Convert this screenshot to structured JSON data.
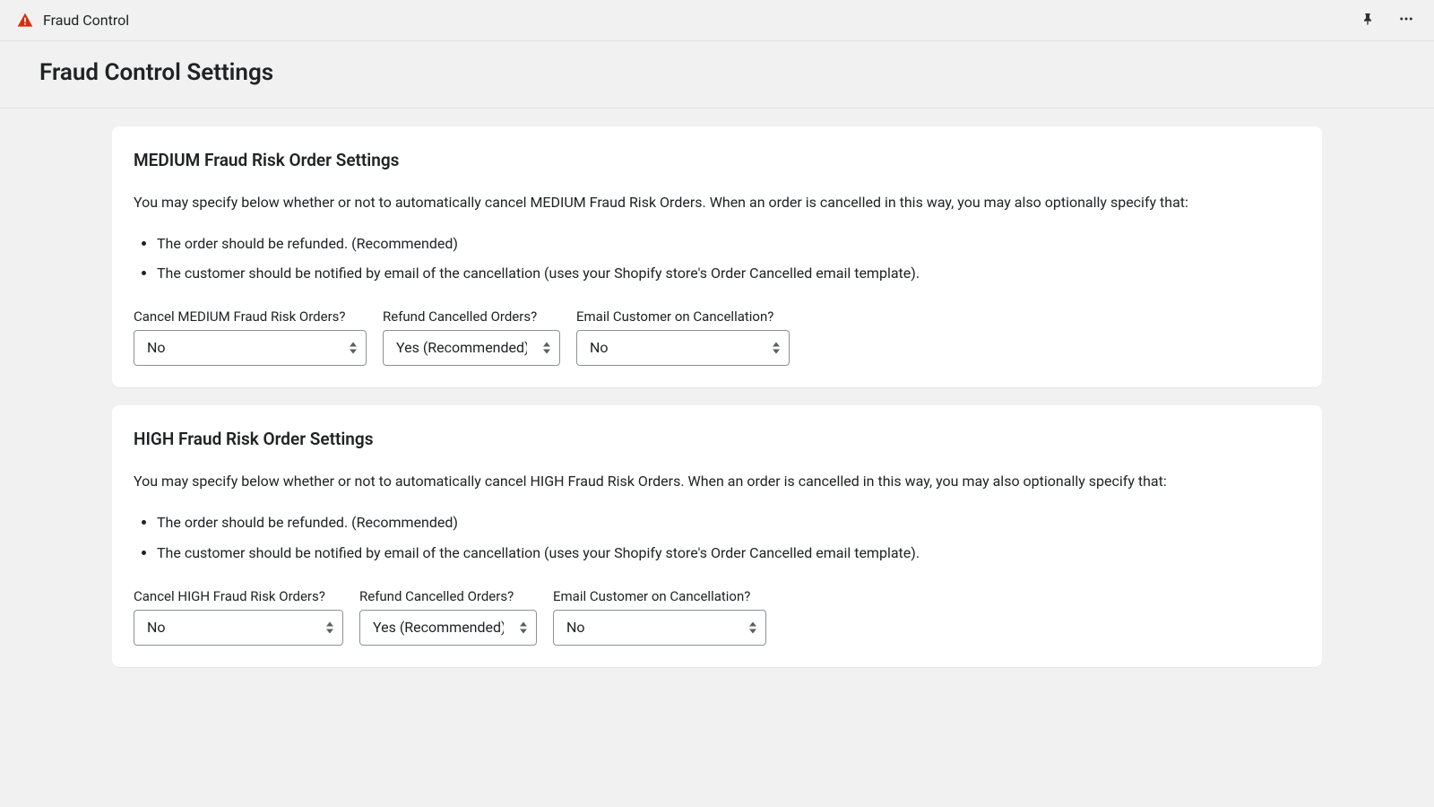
{
  "topbar": {
    "app_name": "Fraud Control"
  },
  "page": {
    "title": "Fraud Control Settings"
  },
  "sections": {
    "medium": {
      "title": "MEDIUM Fraud Risk Order Settings",
      "description": "You may specify below whether or not to automatically cancel MEDIUM Fraud Risk Orders. When an order is cancelled in this way, you may also optionally specify that:",
      "bullets": [
        "The order should be refunded. (Recommended)",
        "The customer should be notified by email of the cancellation (uses your Shopify store's Order Cancelled email template)."
      ],
      "fields": {
        "cancel": {
          "label": "Cancel MEDIUM Fraud Risk Orders?",
          "value": "No"
        },
        "refund": {
          "label": "Refund Cancelled Orders?",
          "value": "Yes (Recommended)"
        },
        "email": {
          "label": "Email Customer on Cancellation?",
          "value": "No"
        }
      }
    },
    "high": {
      "title": "HIGH Fraud Risk Order Settings",
      "description": "You may specify below whether or not to automatically cancel HIGH Fraud Risk Orders. When an order is cancelled in this way, you may also optionally specify that:",
      "bullets": [
        "The order should be refunded. (Recommended)",
        "The customer should be notified by email of the cancellation (uses your Shopify store's Order Cancelled email template)."
      ],
      "fields": {
        "cancel": {
          "label": "Cancel HIGH Fraud Risk Orders?",
          "value": "No"
        },
        "refund": {
          "label": "Refund Cancelled Orders?",
          "value": "Yes (Recommended)"
        },
        "email": {
          "label": "Email Customer on Cancellation?",
          "value": "No"
        }
      }
    }
  }
}
